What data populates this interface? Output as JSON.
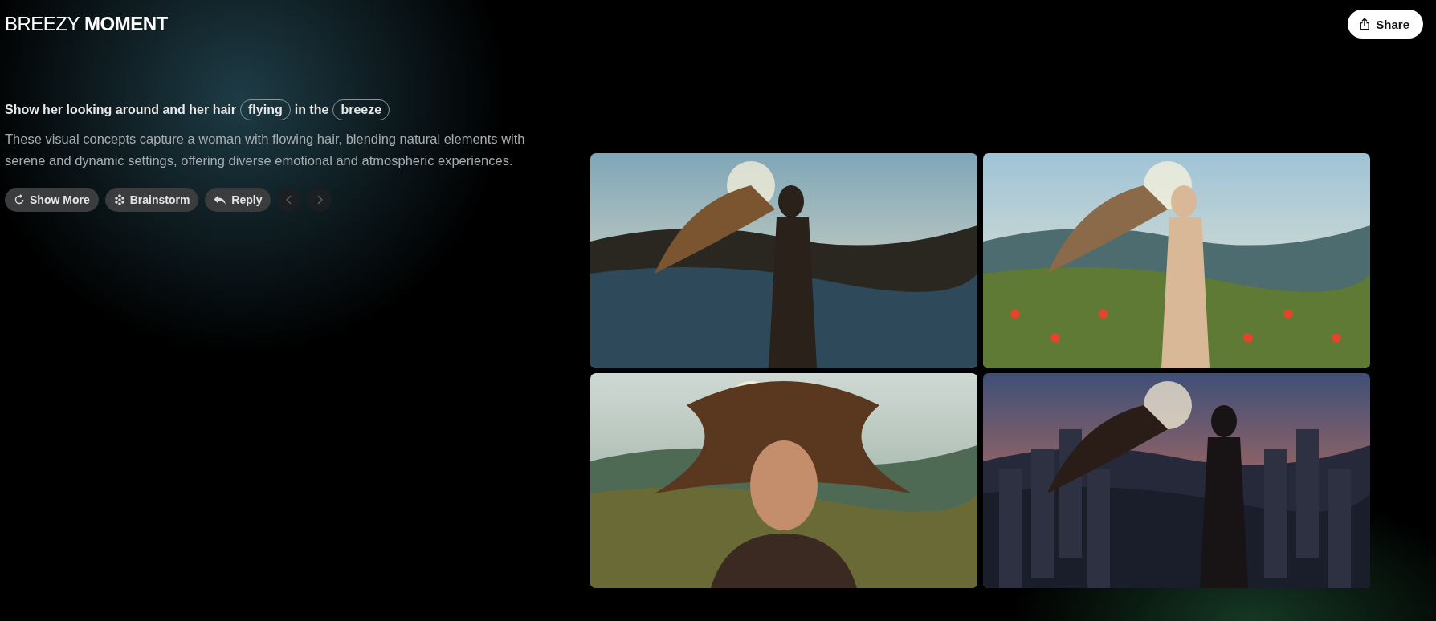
{
  "header": {
    "title_light": "BREEZY",
    "title_bold": "MOMENT",
    "share": "Share"
  },
  "prompt": [
    {
      "kind": "text",
      "text": "Show her looking around and her hair"
    },
    {
      "kind": "chip",
      "text": "flying"
    },
    {
      "kind": "text",
      "text": "in the"
    },
    {
      "kind": "chip",
      "text": "breeze"
    }
  ],
  "description": "These visual concepts capture a woman with flowing hair, blending natural elements with serene and dynamic settings, offering diverse emotional and atmospheric experiences.",
  "actions": [
    {
      "kind": "refresh",
      "label": "Show More"
    },
    {
      "kind": "brainstorm",
      "label": "Brainstorm"
    },
    {
      "kind": "reply",
      "label": "Reply"
    }
  ],
  "nav": [
    {
      "kind": "prev",
      "disabled": true
    },
    {
      "kind": "next",
      "disabled": true
    }
  ],
  "images": [
    {
      "kind": "figure-picture"
    },
    {
      "kind": "figure-picture"
    },
    {
      "kind": "figure-picture"
    },
    {
      "kind": "figure-picture"
    }
  ]
}
